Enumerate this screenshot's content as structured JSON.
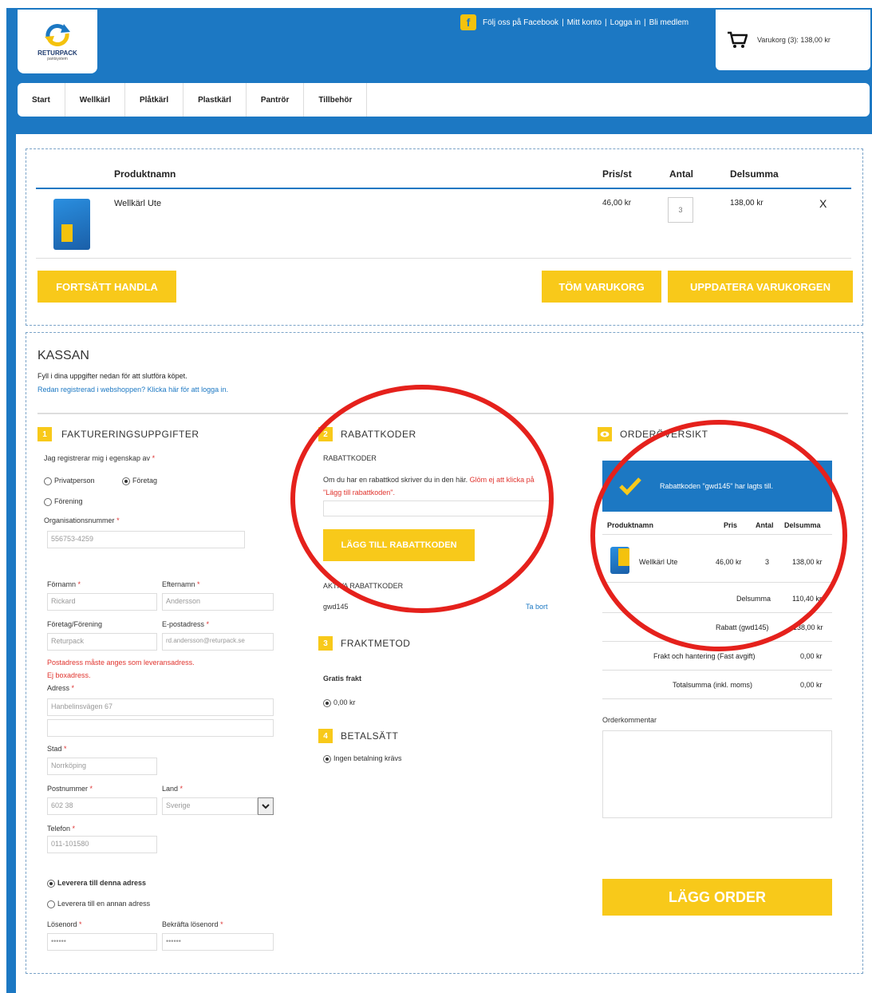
{
  "brand": {
    "logo_text": "RETURPACK",
    "logo_sub": "pantsystem"
  },
  "toplinks": {
    "facebook": "Följ oss på Facebook",
    "sep1": "|",
    "account": "Mitt konto",
    "sep2": "|",
    "login": "Logga in",
    "sep3": "|",
    "member": "Bli medlem"
  },
  "cart": {
    "label": "Varukorg (3): 138,00 kr"
  },
  "nav": [
    "Start",
    "Wellkärl",
    "Plåtkärl",
    "Plastkärl",
    "Pantrör",
    "Tillbehör"
  ],
  "cart_table": {
    "headers": {
      "name": "Produktnamn",
      "price": "Pris/st",
      "qty": "Antal",
      "subtotal": "Delsumma"
    },
    "row": {
      "name": "Wellkärl Ute",
      "price": "46,00 kr",
      "qty": "3",
      "subtotal": "138,00 kr",
      "remove": "X"
    },
    "buttons": {
      "continue": "FORTSÄTT HANDLA",
      "empty": "TÖM VARUKORG",
      "update": "UPPDATERA VARUKORGEN"
    }
  },
  "checkout": {
    "title": "KASSAN",
    "intro": "Fyll i dina uppgifter nedan för att slutföra köpet.",
    "login_link": "Redan registrerad i webshoppen? Klicka här för att logga in.",
    "billing": {
      "num": "1",
      "title": "FAKTURERINGSUPPGIFTER",
      "register_as": "Jag registrerar mig i egenskap av",
      "opt_private": "Privatperson",
      "opt_company": "Företag",
      "opt_association": "Förening",
      "org_label": "Organisationsnummer",
      "org_value": "556753-4259",
      "first_label": "Förnamn",
      "first_value": "Rickard",
      "last_label": "Efternamn",
      "last_value": "Andersson",
      "company_label": "Företag/Förening",
      "company_value": "Returpack",
      "email_label": "E-postadress",
      "email_value": "rd.andersson@returpack.se",
      "note1": "Postadress måste anges som leveransadress.",
      "note2": "Ej boxadress.",
      "address_label": "Adress",
      "address_value": "Hanbelinsvägen 67",
      "city_label": "Stad",
      "city_value": "Norrköping",
      "zip_label": "Postnummer",
      "zip_value": "602 38",
      "country_label": "Land",
      "country_value": "Sverige",
      "phone_label": "Telefon",
      "phone_value": "011-101580",
      "deliver_same": "Leverera till denna adress",
      "deliver_other": "Leverera till en annan adress",
      "pw_label": "Lösenord",
      "pw_value": "••••••",
      "pw2_label": "Bekräfta lösenord",
      "pw2_value": "••••••"
    },
    "discount": {
      "num": "2",
      "title": "RABATTKODER",
      "sub": "RABATTKODER",
      "text1": "Om du har en rabattkod skriver du in den här.",
      "text2": "Glöm ej att klicka på \"Lägg till rabattkoden\".",
      "button": "LÄGG TILL RABATTKODEN",
      "active_label": "AKTIVA RABATTKODER",
      "active_code": "gwd145",
      "remove": "Ta bort"
    },
    "shipping": {
      "num": "3",
      "title": "FRAKTMETOD",
      "method": "Gratis frakt",
      "price": "0,00 kr"
    },
    "payment": {
      "num": "4",
      "title": "BETALSÄTT",
      "option": "Ingen betalning krävs"
    },
    "overview": {
      "title": "ORDERÖVERSIKT",
      "success": "Rabattkoden \"gwd145\" har lagts till.",
      "headers": {
        "name": "Produktnamn",
        "price": "Pris",
        "qty": "Antal",
        "subtotal": "Delsumma"
      },
      "row": {
        "name": "Wellkärl Ute",
        "price": "46,00 kr",
        "qty": "3",
        "subtotal": "138,00 kr"
      },
      "subtotal_label": "Delsumma",
      "subtotal_value": "110,40 kr",
      "discount_label": "Rabatt (gwd145)",
      "discount_value": "-138,00 kr",
      "shipping_label": "Frakt och hantering (Fast avgift)",
      "shipping_value": "0,00 kr",
      "total_label": "Totalsumma (inkl. moms)",
      "total_value": "0,00 kr",
      "comment_label": "Orderkommentar",
      "order_button": "LÄGG ORDER"
    }
  },
  "colors": {
    "brand_blue": "#1c78c3",
    "accent_yellow": "#f8c91a",
    "annotation_red": "#e5211c"
  }
}
